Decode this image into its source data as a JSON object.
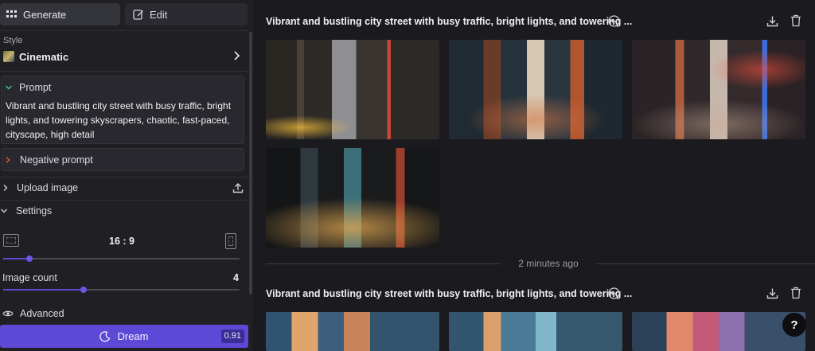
{
  "sidebar": {
    "tabs": {
      "generate": "Generate",
      "edit": "Edit"
    },
    "style": {
      "label": "Style",
      "value": "Cinematic"
    },
    "prompt": {
      "label": "Prompt",
      "text": "Vibrant and bustling city street with busy traffic, bright lights, and towering skyscrapers, chaotic, fast-paced, cityscape, high detail"
    },
    "negative_prompt": {
      "label": "Negative prompt"
    },
    "upload_image": {
      "label": "Upload image"
    },
    "settings": {
      "label": "Settings",
      "aspect_ratio": "16 : 9",
      "aspect_slider_fraction": 0.11,
      "image_count_label": "Image count",
      "image_count": "4",
      "image_count_fraction": 0.34
    },
    "advanced": {
      "label": "Advanced"
    },
    "dream": {
      "label": "Dream",
      "cost": "0.91"
    }
  },
  "gallery": {
    "sets": [
      {
        "title": "Vibrant and bustling city street with busy traffic, bright lights, and towering ..."
      },
      {
        "title": "Vibrant and bustling city street with busy traffic, bright lights, and towering ..."
      }
    ],
    "separator": "2 minutes ago"
  },
  "help": {
    "label": "?"
  },
  "colors": {
    "accent": "#5d49d6",
    "background": "#1b1b1f",
    "panel": "#1f1f24"
  }
}
